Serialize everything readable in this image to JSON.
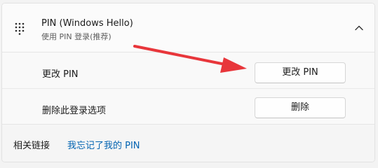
{
  "pin_section": {
    "title": "PIN (Windows Hello)",
    "subtitle": "使用 PIN 登录(推荐)",
    "icon": "keypad-icon",
    "expand_icon": "chevron-up-icon",
    "expanded": true
  },
  "change_pin": {
    "label": "更改 PIN",
    "button_label": "更改 PIN"
  },
  "remove_pin": {
    "label": "删除此登录选项",
    "button_label": "删除"
  },
  "related_links": {
    "label": "相关链接",
    "forgot_pin_link": "我忘记了我的 PIN"
  },
  "annotation": {
    "type": "arrow",
    "color": "#e8363b",
    "points_to": "change-pin-button"
  },
  "colors": {
    "link": "#0063b1",
    "background": "#f3f3f3",
    "card": "#fbfbfb"
  }
}
